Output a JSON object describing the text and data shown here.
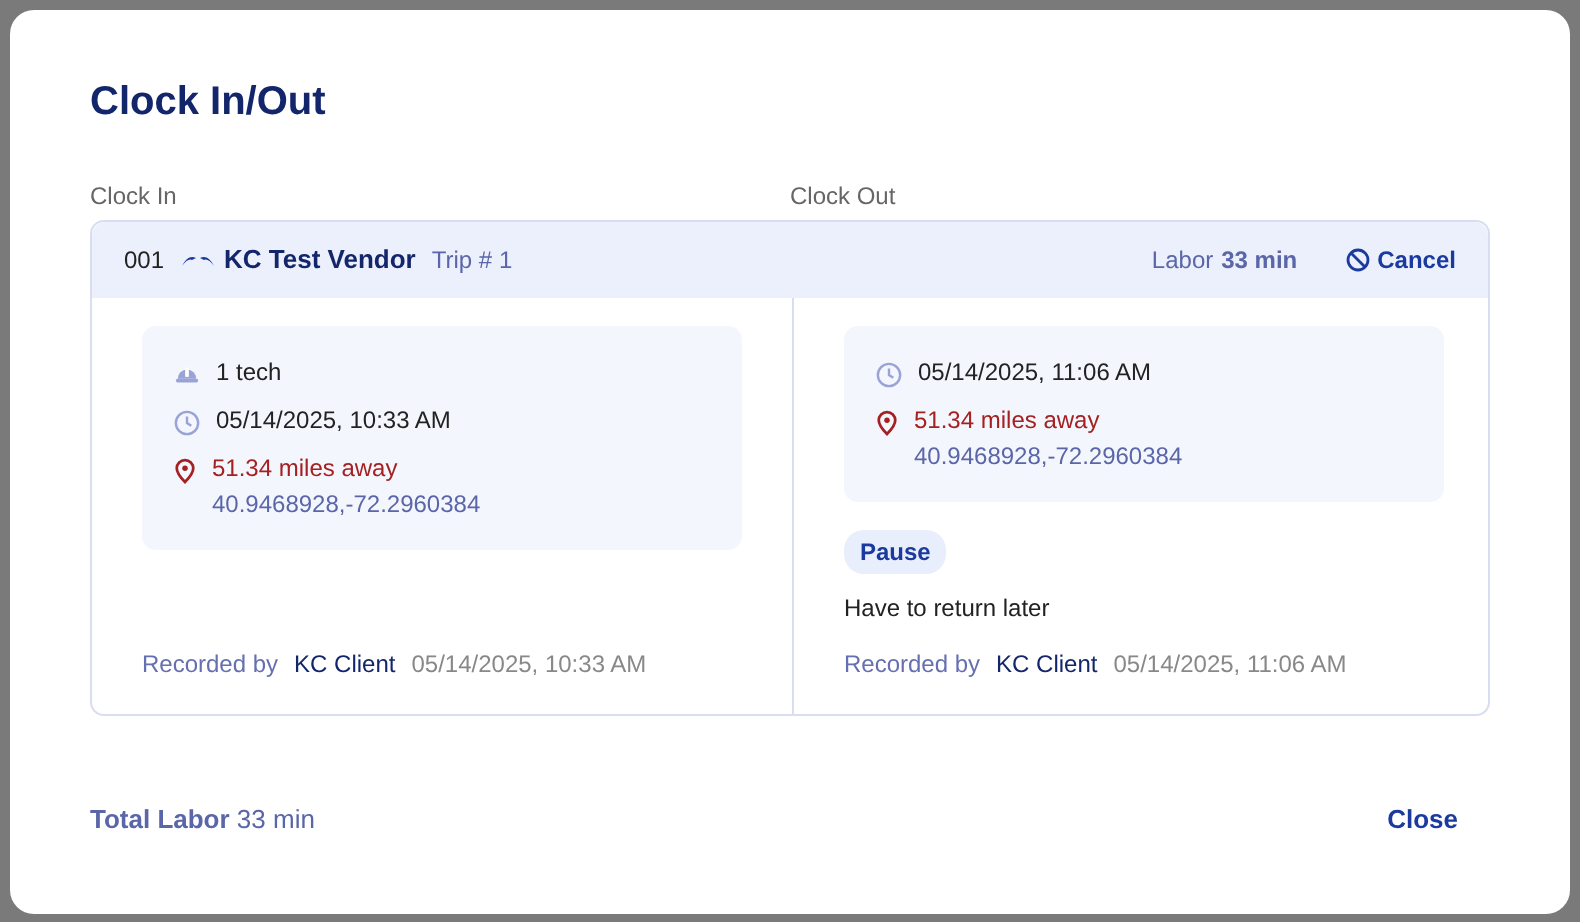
{
  "title": "Clock In/Out",
  "column_labels": [
    "Clock In",
    "Clock Out"
  ],
  "entry": {
    "number": "001",
    "vendor": "KC Test Vendor",
    "trip": "Trip # 1",
    "labor_label": "Labor",
    "labor_value": "33 min",
    "cancel": "Cancel",
    "sides": [
      {
        "details": [
          {
            "kind": "techs",
            "text": "1 tech"
          },
          {
            "kind": "time",
            "text": "05/14/2025, 10:33 AM"
          },
          {
            "kind": "location",
            "distance": "51.34 miles away",
            "coords": "40.9468928,-72.2960384"
          }
        ],
        "recorded_label": "Recorded by",
        "recorded_by": "KC Client",
        "recorded_at": "05/14/2025, 10:33 AM"
      },
      {
        "details": [
          {
            "kind": "time",
            "text": "05/14/2025, 11:06 AM"
          },
          {
            "kind": "location",
            "distance": "51.34 miles away",
            "coords": "40.9468928,-72.2960384"
          }
        ],
        "tag": "Pause",
        "note": "Have to return later",
        "recorded_label": "Recorded by",
        "recorded_by": "KC Client",
        "recorded_at": "05/14/2025, 11:06 AM"
      }
    ]
  },
  "footer": {
    "total": "**Total Labor** 33 min",
    "close": "Close"
  }
}
